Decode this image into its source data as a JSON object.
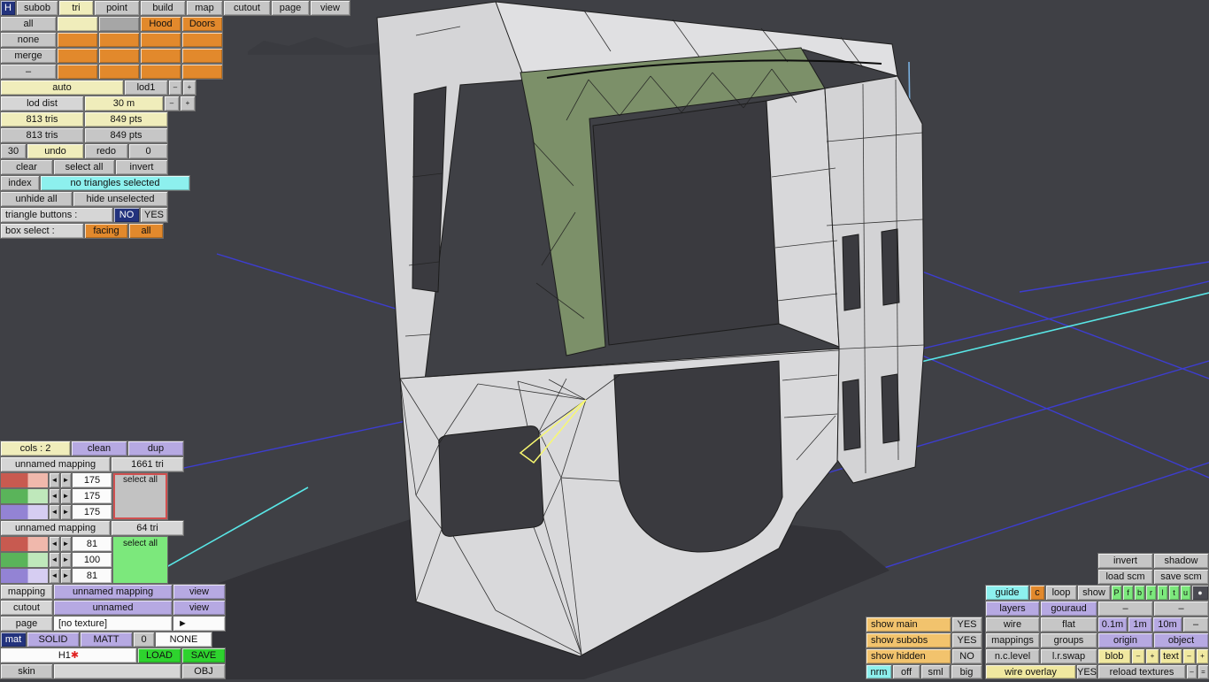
{
  "colors": {
    "viewport_bg": "#3f4045",
    "grid_blue": "#3d3de0",
    "accent_cyan": "#59e6e6",
    "body_green": "#7c9069",
    "ui_orange": "#e2892c",
    "ui_purple": "#b6a9e2",
    "ui_green": "#2ed32e"
  },
  "menu": {
    "items": [
      "H",
      "subob",
      "tri",
      "point",
      "build",
      "map",
      "cutout",
      "page",
      "view"
    ]
  },
  "subob": {
    "side": [
      "all",
      "none",
      "merge",
      "–"
    ],
    "groups": [
      "Hood",
      "Doors"
    ]
  },
  "lod": {
    "auto": "auto",
    "level": "lod1",
    "minus": "–",
    "plus": "+",
    "dist_label": "lod dist",
    "dist_value": "30 m"
  },
  "stats": {
    "r1c1": "813 tris",
    "r1c2": "849 pts",
    "r2c1": "813 tris",
    "r2c2": "849 pts"
  },
  "history": {
    "undo_count": "30",
    "undo": "undo",
    "redo": "redo",
    "redo_count": "0"
  },
  "selection": {
    "clear": "clear",
    "select_all": "select all",
    "invert": "invert",
    "index": "index",
    "status": "no triangles selected",
    "unhide": "unhide all",
    "hide": "hide unselected",
    "tri_label": "triangle buttons :",
    "no": "NO",
    "yes": "YES",
    "box_label": "box select :",
    "facing": "facing",
    "all": "all"
  },
  "mappings": {
    "cols": "cols : 2",
    "clean": "clean",
    "dup": "dup",
    "arrow_left": "◄",
    "arrow_right": "►",
    "groups": [
      {
        "name": "unnamed mapping",
        "tris": "1661 tri",
        "values": [
          "175",
          "175",
          "175"
        ],
        "select_all": "select all"
      },
      {
        "name": "unnamed mapping",
        "tris": "64 tri",
        "values": [
          "81",
          "100",
          "81"
        ],
        "select_all": "select all"
      }
    ],
    "mapping_label": "mapping",
    "mapping_name": "unnamed mapping",
    "view": "view",
    "cutout_label": "cutout",
    "cutout_name": "unnamed",
    "page_label": "page",
    "page_value": "[no texture]",
    "page_next": "►",
    "mat_label": "mat",
    "solid": "SOLID",
    "matt": "MATT",
    "num": "0",
    "none": "NONE",
    "file": "H1",
    "file_mark": "✱",
    "load": "LOAD",
    "save": "SAVE",
    "skin": "skin",
    "obj": "OBJ"
  },
  "right": {
    "invert": "invert",
    "shadow": "shadow",
    "load_scm": "load scm",
    "save_scm": "save scm",
    "guide": "guide",
    "c": "c",
    "loop": "loop",
    "show": "show",
    "letters": [
      "P",
      "f",
      "b",
      "r",
      "l",
      "t",
      "u"
    ],
    "dot": "●",
    "layers": "layers",
    "gouraud": "gouraud",
    "dash": "–",
    "plus": "+",
    "eq": "=",
    "show_main": "show main",
    "show_subobs": "show subobs",
    "show_hidden": "show hidden",
    "yes": "YES",
    "no": "NO",
    "wire": "wire",
    "flat": "flat",
    "g01": "0.1m",
    "g1": "1m",
    "g10": "10m",
    "mappings": "mappings",
    "groups": "groups",
    "origin": "origin",
    "object": "object",
    "nclevel": "n.c.level",
    "lrswap": "l.r.swap",
    "blob": "blob",
    "text": "text",
    "nrm": "nrm",
    "off": "off",
    "sml": "sml",
    "big": "big",
    "wire_overlay": "wire overlay",
    "reload": "reload textures"
  }
}
